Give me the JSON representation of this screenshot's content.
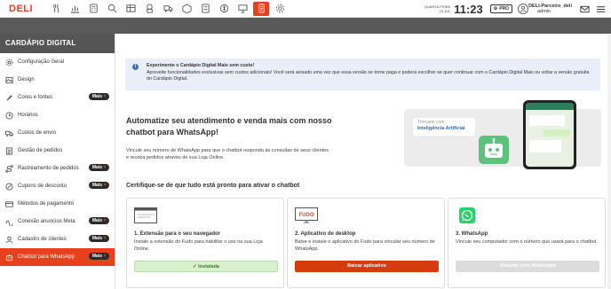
{
  "brand": {
    "logo": "DELI"
  },
  "header": {
    "weekday": "QUARTA-FEIRA",
    "date": "23 JUL",
    "time": "11:23",
    "plan": "PRO",
    "user_name": "DELI-Parceiro_deli",
    "user_role": "admin",
    "toolbar_icons": [
      "utensils-icon",
      "chart-icon",
      "cashier-icon",
      "search-icon",
      "table-icon",
      "chef-icon",
      "delivery-truck-icon",
      "box-icon",
      "money-icon",
      "coin-icon",
      "monitor-icon",
      "qr-menu-icon",
      "gear-icon"
    ],
    "active_icon": "qr-menu-icon"
  },
  "sidebar": {
    "title": "CARDÁPIO DIGITAL",
    "badge_label": "Mais",
    "items": [
      {
        "label": "Configuração Geral",
        "icon": "gear-icon",
        "badge": false
      },
      {
        "label": "Design",
        "icon": "image-icon",
        "badge": false
      },
      {
        "label": "Cores e fontes",
        "icon": "brush-icon",
        "badge": true
      },
      {
        "label": "Horários",
        "icon": "clock-icon",
        "badge": false
      },
      {
        "label": "Custos de envio",
        "icon": "truck-icon",
        "badge": false
      },
      {
        "label": "Gestão de pedidos",
        "icon": "list-icon",
        "badge": false
      },
      {
        "label": "Rastreamento de pedidos",
        "icon": "route-icon",
        "badge": true
      },
      {
        "label": "Cupons de desconto",
        "icon": "percent-icon",
        "badge": true
      },
      {
        "label": "Métodos de pagamento",
        "icon": "card-icon",
        "badge": false
      },
      {
        "label": "Conexão anuncios Meta",
        "icon": "meta-icon",
        "badge": true
      },
      {
        "label": "Cadastro de clientes",
        "icon": "user-icon",
        "badge": true
      },
      {
        "label": "Chatbot para WhatsApp",
        "icon": "robot-icon",
        "badge": true,
        "active": true
      }
    ]
  },
  "notice": {
    "title": "Experimente o Cardápio Digital Mais sem custo!",
    "body": "Aproveite funcionalidades exclusivas sem custos adicionais! Você será avisado uma vez que essa versão se torne paga e poderá escolher se quer continuar com o Cardápio Digital Mais ou voltar a versão gratuita do Cardápio Digital."
  },
  "hero": {
    "title": "Automatize seu atendimento e venda mais com nosso chatbot para WhatsApp!",
    "text": "Vincule seu número de WhatsApp para que o chatbot responda às consultas de seus clientes e receba pedidos através de sua Loja Online."
  },
  "promo": {
    "small": "Treinado com",
    "big": "Inteligência Artificial"
  },
  "checklist": {
    "title": "Certifique-se de que tudo está pronto para ativar o chatbot",
    "cards": [
      {
        "title": "1. Extensão para o seu navegador",
        "desc": "Instale a extensão do Fudo para habilitar o uso na sua Loja Online.",
        "button": "Instalada",
        "state": "done"
      },
      {
        "title": "2. Aplicativo de desktop",
        "desc": "Baixe e instale o aplicativo do Fudo para vincular seu número de WhatsApp.",
        "button": "Baixar aplicativo",
        "state": "action",
        "image_text": "FUDO"
      },
      {
        "title": "3. WhatsApp",
        "desc": "Vincule seu computador com o número que usará para o chatbot.",
        "button": "Vincular com WhatsApp",
        "state": "disabled"
      }
    ]
  },
  "colors": {
    "accent": "#e8401c",
    "dark": "#555555",
    "notice_bg": "#e9eef9",
    "success_bg": "#d8f0cc",
    "whatsapp": "#25d366"
  }
}
